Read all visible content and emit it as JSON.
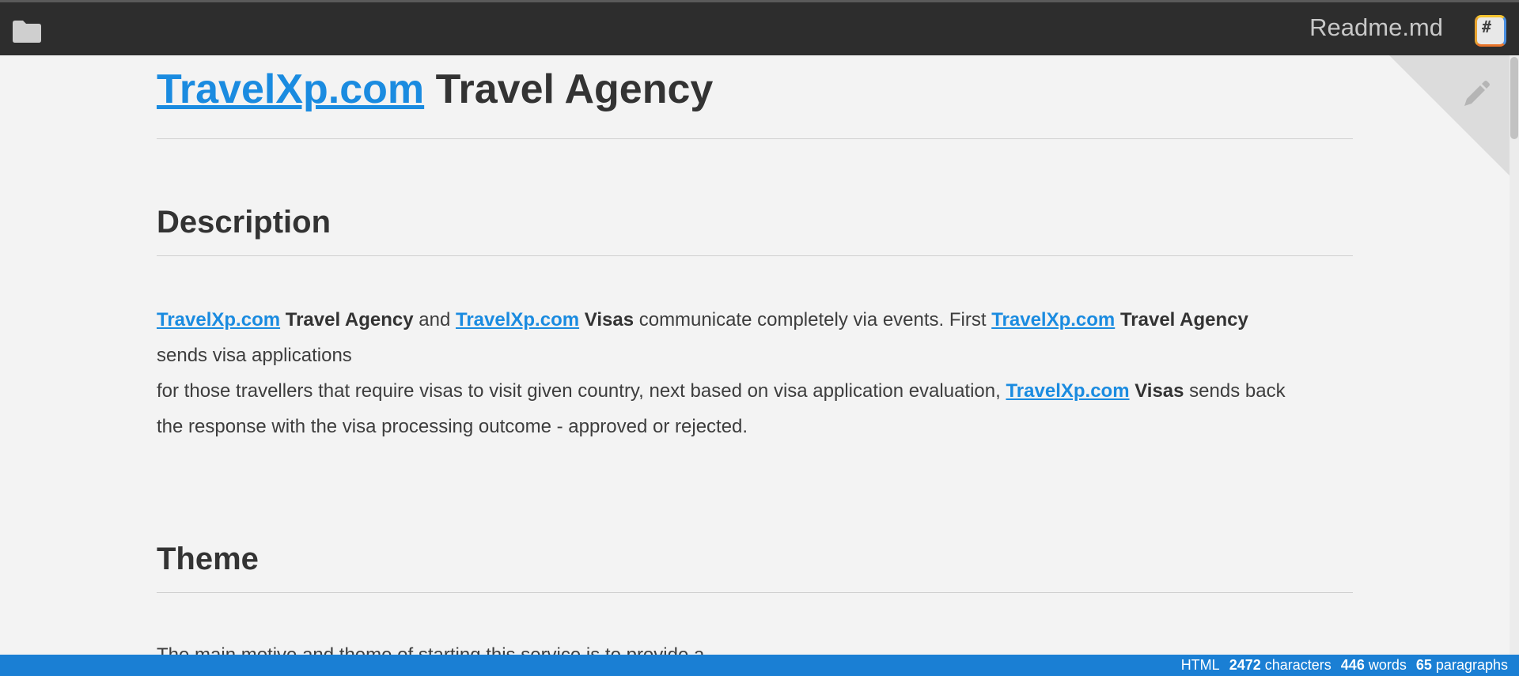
{
  "header": {
    "filename": "Readme.md",
    "md_icon_glyph": "#"
  },
  "doc": {
    "h1_link": "TravelXp.com",
    "h1_rest": " Travel Agency",
    "h2_description": "Description",
    "desc": {
      "link1": "TravelXp.com",
      "bold1": "Travel Agency",
      "t1": " and ",
      "link2": "TravelXp.com",
      "bold2": "Visas",
      "t2": " communicate completely via events. First ",
      "link3": "TravelXp.com",
      "bold3": "Travel Agency",
      "line2": "sends visa applications",
      "t3": "for those travellers that require visas to visit given country, next based on visa application evaluation, ",
      "link4": "TravelXp.com",
      "bold4": "Visas",
      "t4": " sends back",
      "line4": "the response with the visa processing outcome - approved or rejected."
    },
    "h2_theme": "Theme",
    "theme_text": "The main motive and theme of starting this service is to provide a"
  },
  "status": {
    "mode": "HTML",
    "characters_count": "2472",
    "characters_label": "characters",
    "words_count": "446",
    "words_label": "words",
    "paragraphs_count": "65",
    "paragraphs_label": "paragraphs"
  },
  "colors": {
    "topbar": "#2d2d2d",
    "link": "#1a8be0",
    "statusbar": "#1a7fd4",
    "background": "#f3f3f3"
  }
}
